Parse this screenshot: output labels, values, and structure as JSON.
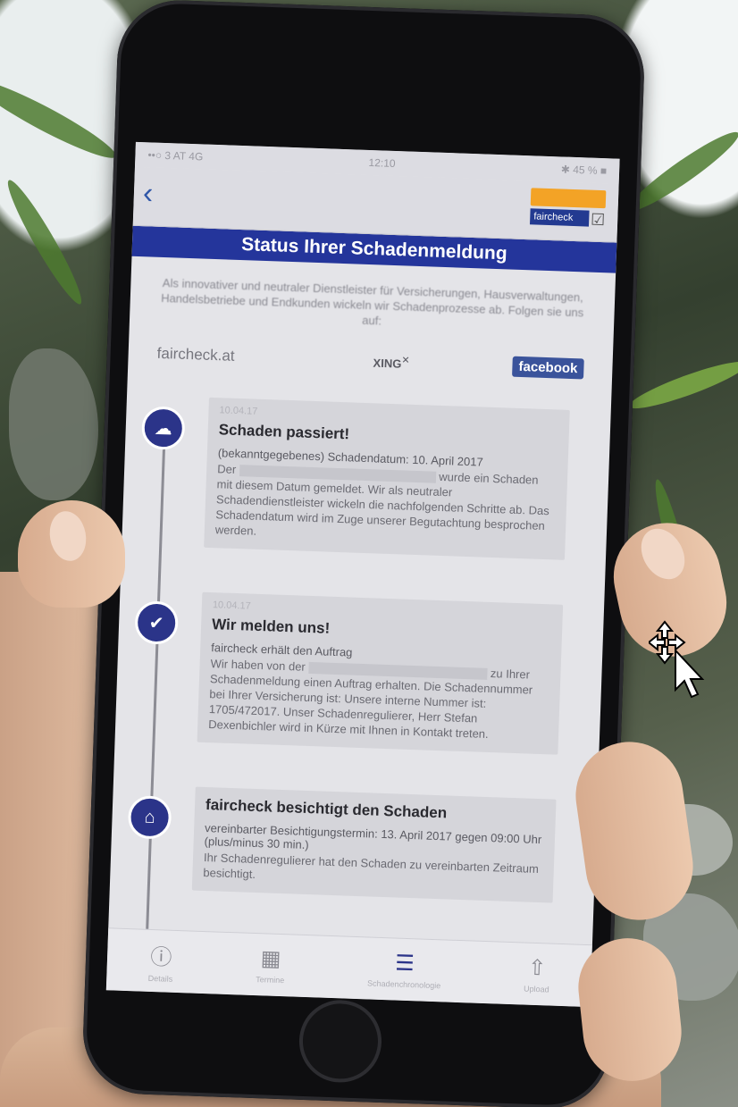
{
  "screen": {
    "statusbar": {
      "carrier": "••○ 3 AT  4G",
      "time": "12:10",
      "battery": "✱ 45 % ■"
    },
    "navbar": {
      "back_icon": "chevron-left-icon",
      "logo_text": "faircheck"
    },
    "title": "Status Ihrer Schadenmeldung",
    "intro": "Als innovativer und neutraler Dienstleister für Versicherungen, Hausverwaltungen, Handelsbetriebe und Endkunden wickeln wir Schadenprozesse ab. Folgen sie uns auf:",
    "links": {
      "faircheck": "faircheck.at",
      "xing": "XING",
      "facebook": "facebook"
    },
    "timeline": [
      {
        "icon": "cloud-rain-icon",
        "date": "10.04.17",
        "title": "Schaden passiert!",
        "subtitle": "(bekanntgegebenes) Schadendatum: 10. April 2017",
        "body_pre": "Der",
        "body_post": "wurde ein Schaden mit diesem Datum gemeldet. Wir als neutraler Schadendienstleister wickeln die nachfolgenden Schritte ab. Das Schadendatum wird im Zuge unserer Begutachtung besprochen werden."
      },
      {
        "icon": "check-icon",
        "date": "10.04.17",
        "title": "Wir melden uns!",
        "subtitle": "faircheck erhält den Auftrag",
        "body_pre": "Wir haben von der",
        "body_post": "zu Ihrer Schadenmeldung einen Auftrag erhalten. Die Schadennummer bei Ihrer Versicherung ist: Unsere interne Nummer ist: 1705/472017. Unser Schadenregulierer, Herr Stefan Dexenbichler wird in Kürze mit Ihnen in Kontakt treten."
      },
      {
        "icon": "home-icon",
        "date": "",
        "title": "faircheck besichtigt den Schaden",
        "subtitle": "vereinbarter Besichtigungstermin: 13. April 2017 gegen 09:00 Uhr (plus/minus 30 min.)",
        "body_pre": "",
        "body_post": "Ihr Schadenregulierer hat den Schaden zu vereinbarten Zeitraum besichtigt."
      }
    ],
    "tabbar": [
      {
        "icon": "info-icon",
        "glyph": "ⓘ",
        "label": "Details",
        "active": false
      },
      {
        "icon": "calendar-icon",
        "glyph": "▦",
        "label": "Termine",
        "active": false
      },
      {
        "icon": "list-icon",
        "glyph": "☰",
        "label": "Schadenchronologie",
        "active": true
      },
      {
        "icon": "upload-icon",
        "glyph": "⇧",
        "label": "Upload",
        "active": false
      }
    ]
  },
  "colors": {
    "brand_blue": "#24359b",
    "brand_orange": "#f3a326",
    "facebook_blue": "#3a539b",
    "timeline_icon": "#2b3489"
  }
}
